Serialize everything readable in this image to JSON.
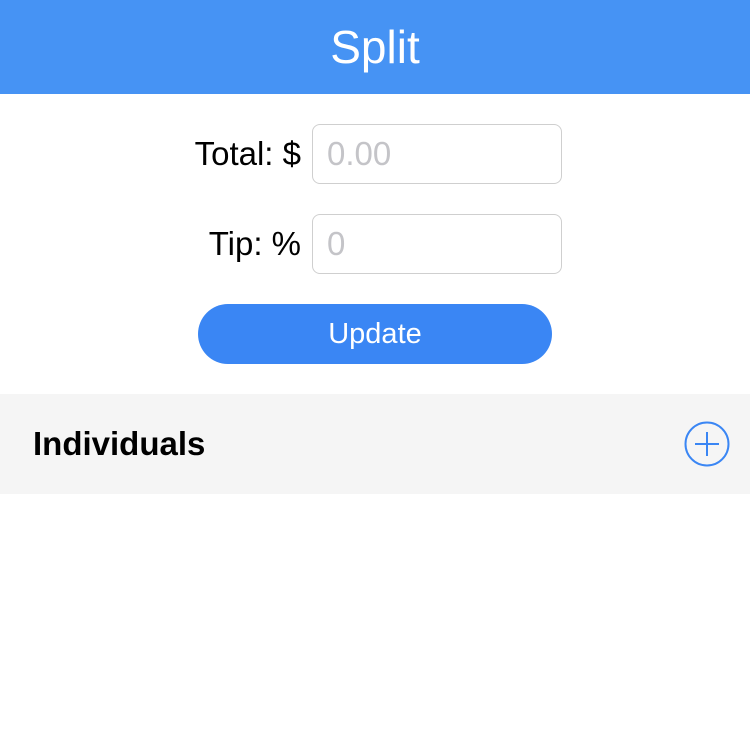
{
  "nav": {
    "title": "Split"
  },
  "form": {
    "total": {
      "label": "Total: $",
      "value": "",
      "placeholder": "0.00"
    },
    "tip": {
      "label": "Tip: %",
      "value": "",
      "placeholder": "0"
    },
    "update_label": "Update"
  },
  "individuals": {
    "title": "Individuals",
    "add_icon": "plus-circle-icon"
  },
  "colors": {
    "nav_background": "#4693f4",
    "accent": "#3a86f4",
    "section_background": "#f5f5f5"
  }
}
